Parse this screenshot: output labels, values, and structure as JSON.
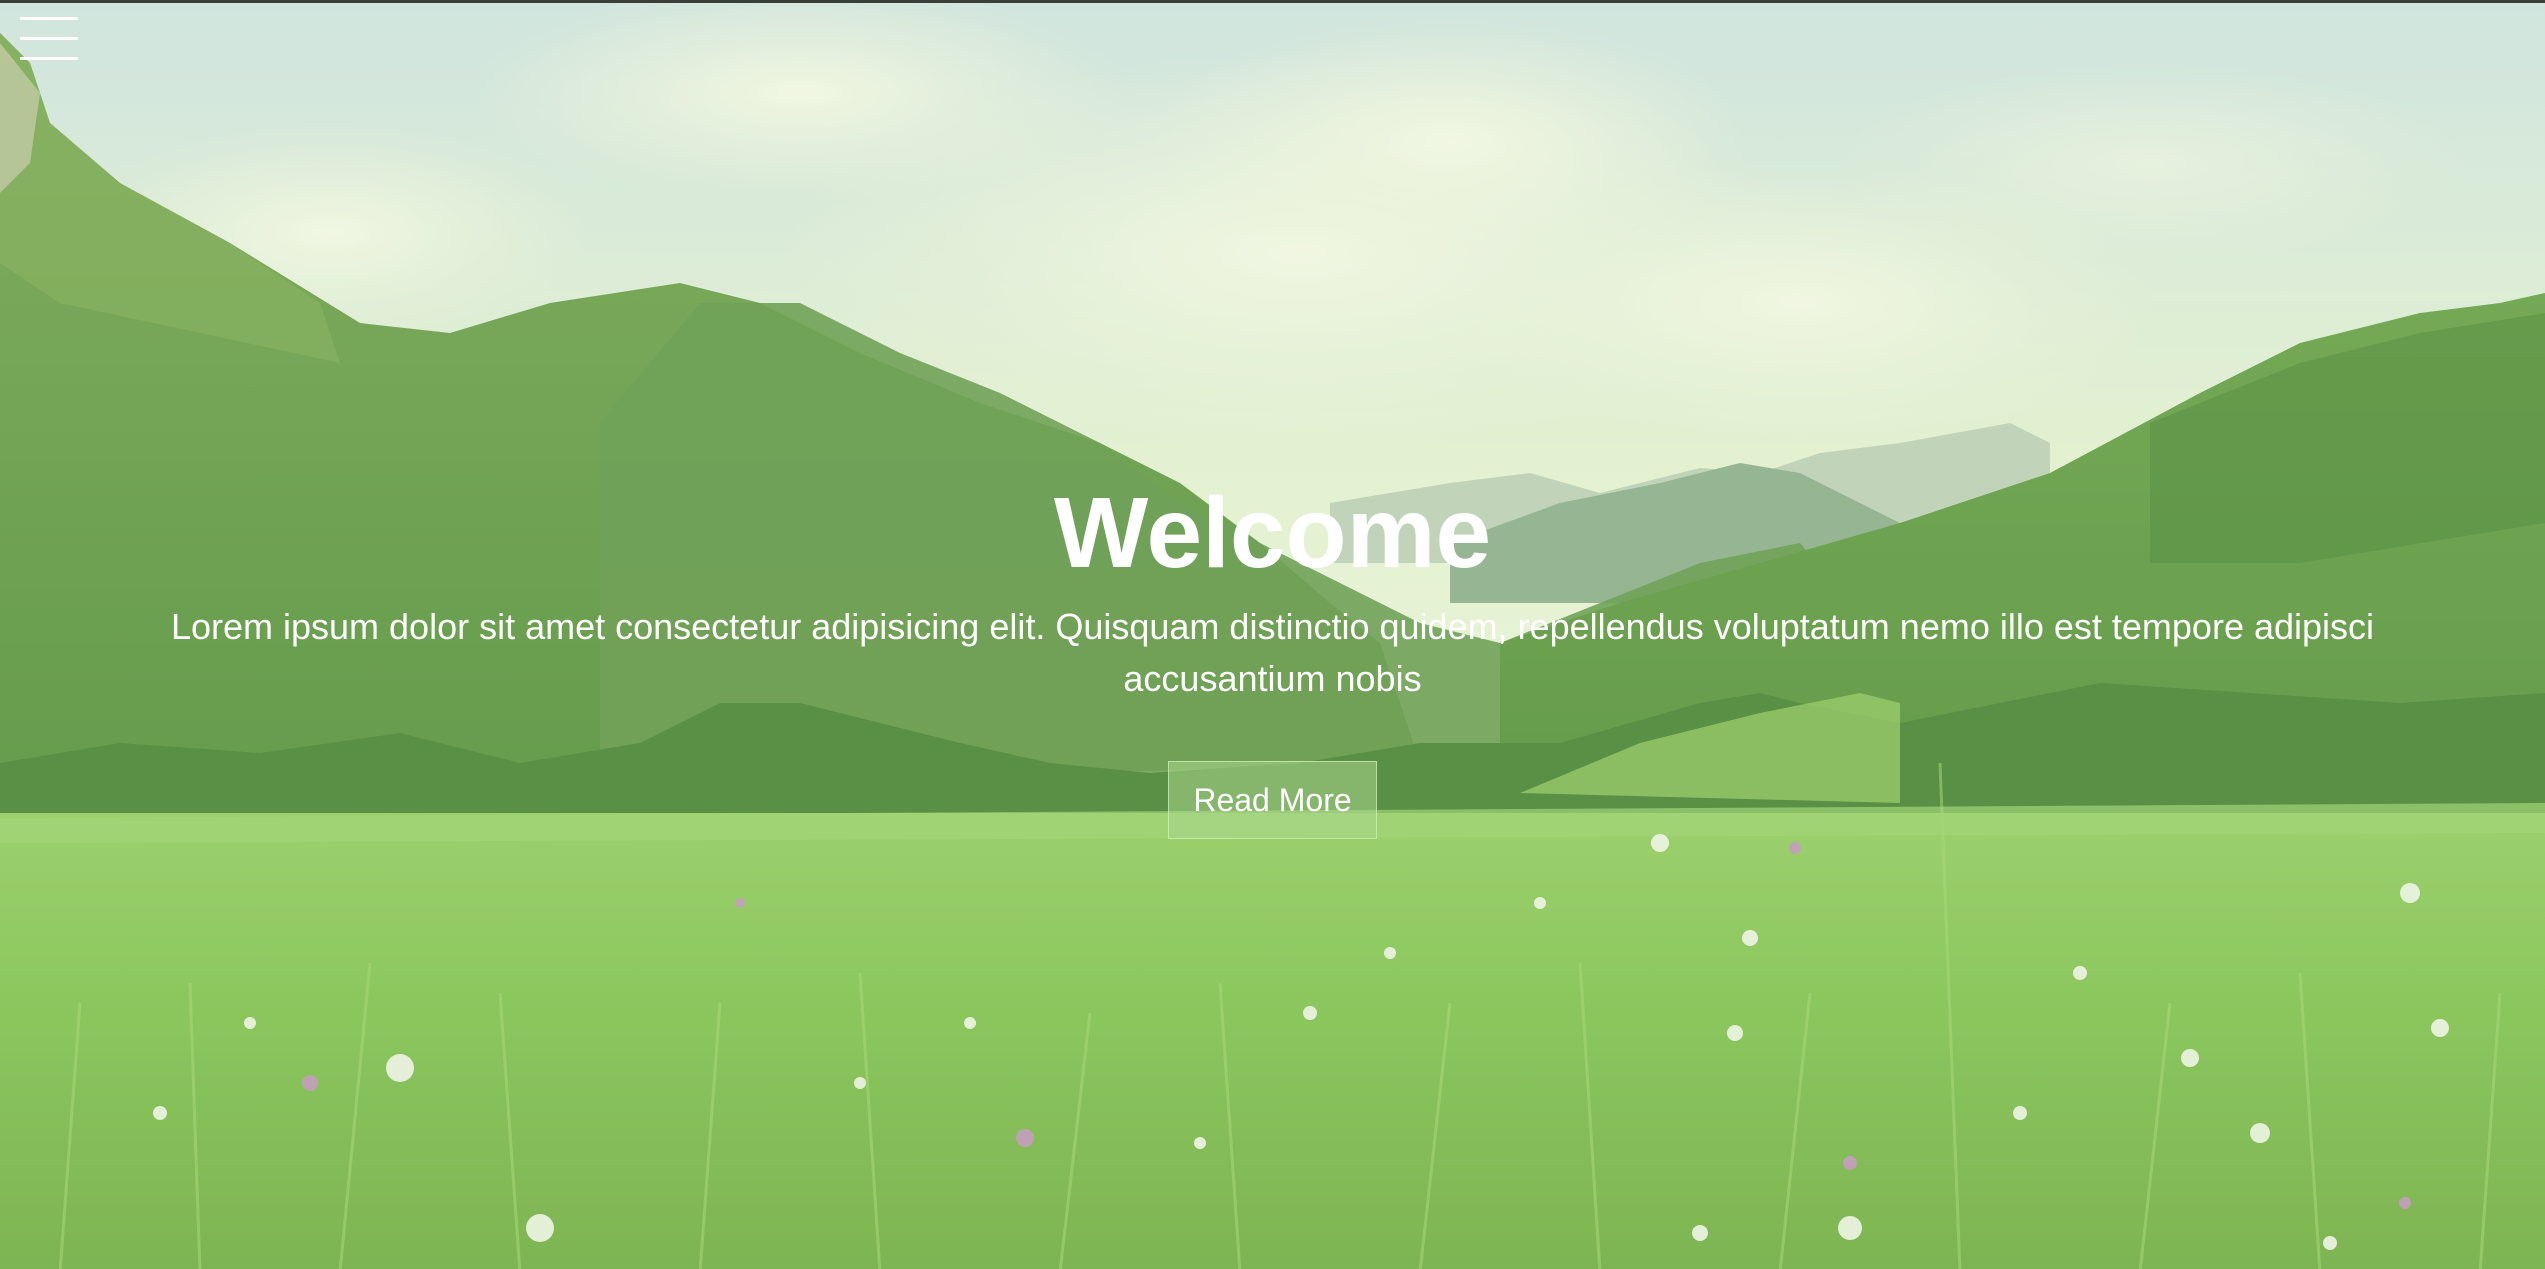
{
  "hero": {
    "title": "Welcome",
    "subtitle": "Lorem ipsum dolor sit amet consectetur adipisicing elit. Quisquam distinctio quidem, repellendus voluptatum nemo illo est tempore adipisci accusantium nobis",
    "button_label": "Read More"
  },
  "nav": {
    "menu_icon": "hamburger-menu-icon"
  },
  "colors": {
    "text": "#ffffff",
    "button_bg": "#aad78c",
    "sky": "#e8f4dc",
    "grass": "#7fbf4e",
    "mountain": "#4f8a3a"
  }
}
